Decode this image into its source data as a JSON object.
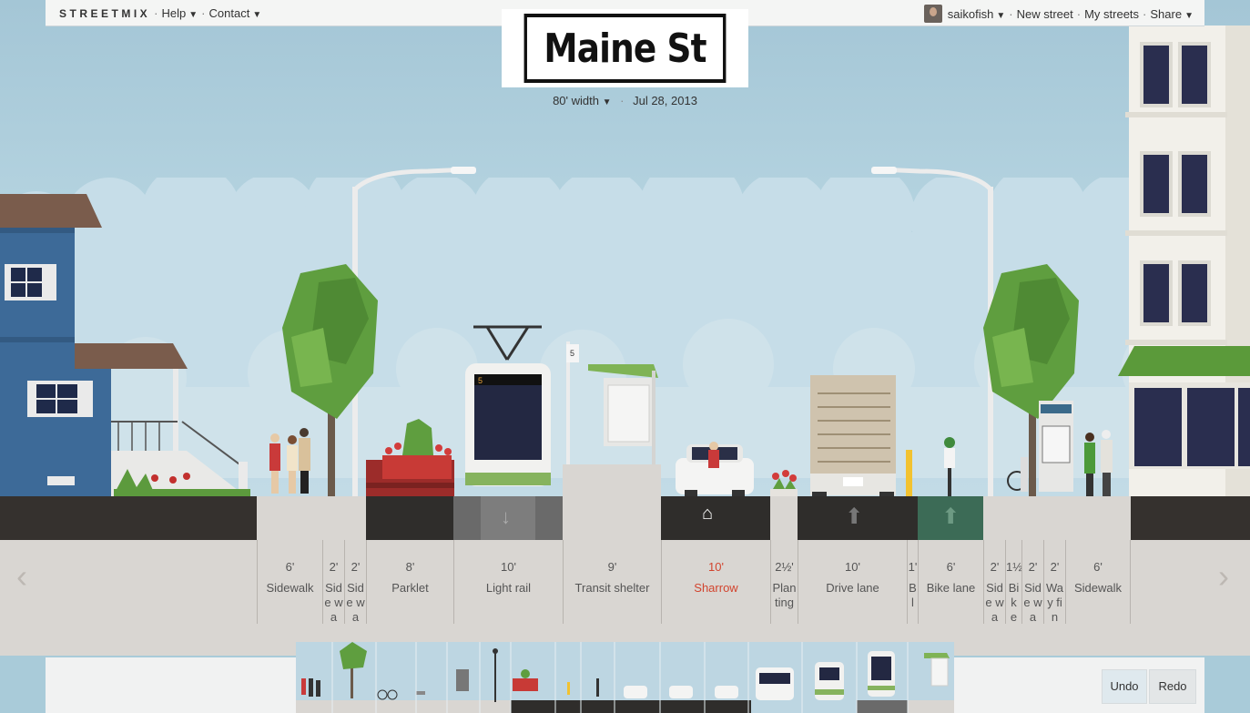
{
  "menu": {
    "logo": "STREETMIX",
    "help": "Help",
    "contact": "Contact",
    "user": "saikofish",
    "new_street": "New street",
    "my_streets": "My streets",
    "share": "Share"
  },
  "street": {
    "name": "Maine St",
    "width": "80' width",
    "date": "Jul 28, 2013"
  },
  "segments": [
    {
      "width": "6'",
      "name": "Sidewalk"
    },
    {
      "width": "2'",
      "name": "Side wa"
    },
    {
      "width": "2'",
      "name": "Side wa"
    },
    {
      "width": "8'",
      "name": "Parklet"
    },
    {
      "width": "10'",
      "name": "Light rail"
    },
    {
      "width": "9'",
      "name": "Transit shelter"
    },
    {
      "width": "10'",
      "name": "Sharrow"
    },
    {
      "width": "2½'",
      "name": "Plan ting"
    },
    {
      "width": "10'",
      "name": "Drive lane"
    },
    {
      "width": "1'",
      "name": "B l"
    },
    {
      "width": "6'",
      "name": "Bike lane"
    },
    {
      "width": "2'",
      "name": "Side wa"
    },
    {
      "width": "1½",
      "name": "Bik e"
    },
    {
      "width": "2'",
      "name": "Side wa"
    },
    {
      "width": "2'",
      "name": "Way fin"
    },
    {
      "width": "6'",
      "name": "Sidewalk"
    }
  ],
  "palette": {
    "undo": "Undo",
    "redo": "Redo"
  },
  "colors": {
    "sky": "#b3d2df",
    "road": "#2f2d2b",
    "sidewalk": "#d9d6d2",
    "bike_lane": "#3c6b56",
    "light_rail": "#6a6a6a",
    "accent_red": "#d2442e"
  }
}
